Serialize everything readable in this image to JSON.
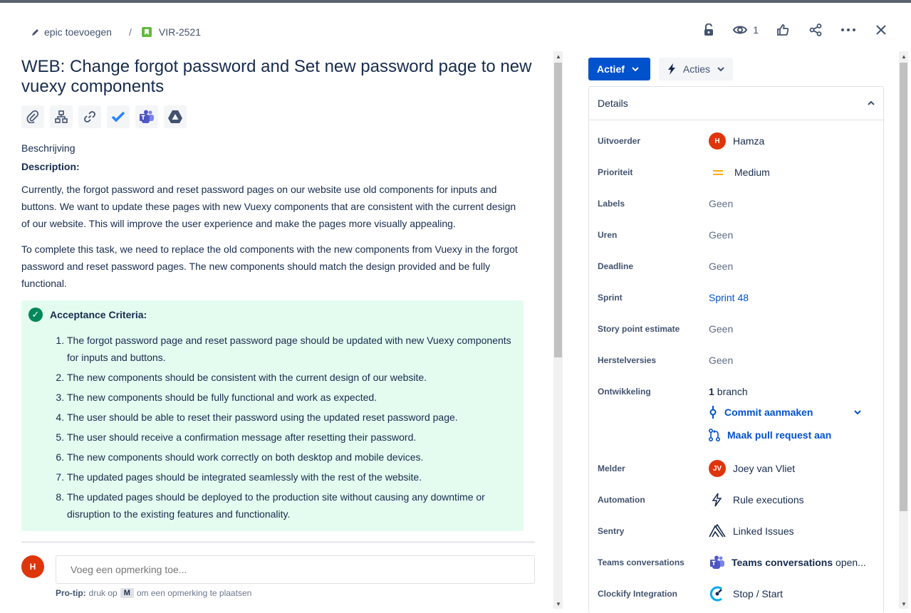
{
  "breadcrumb": {
    "parent_label": "epic toevoegen",
    "separator": "/",
    "issue_key": "VIR-2521"
  },
  "top_actions": {
    "watch_count": "1"
  },
  "issue": {
    "title": "WEB: Change forgot password and Set new password page to new vuexy components",
    "section_label": "Beschrijving",
    "description_heading": "Description:",
    "paragraphs": [
      "Currently, the forgot password and reset password pages on our website use old components for inputs and buttons. We want to update these pages with new Vuexy components that are consistent with the current design of our website. This will improve the user experience and make the pages more visually appealing.",
      "To complete this task, we need to replace the old components with the new components from Vuexy in the forgot password and reset password pages. The new components should match the design provided and be fully functional."
    ],
    "criteria_title": "Acceptance Criteria:",
    "criteria": [
      "The forgot password page and reset password page should be updated with new Vuexy components for inputs and buttons.",
      "The new components should be consistent with the current design of our website.",
      "The new components should be fully functional and work as expected.",
      "The user should be able to reset their password using the updated reset password page.",
      "The user should receive a confirmation message after resetting their password.",
      "The new components should work correctly on both desktop and mobile devices.",
      "The updated pages should be integrated seamlessly with the rest of the website.",
      "The updated pages should be deployed to the production site without causing any downtime or disruption to the existing features and functionality."
    ]
  },
  "comment": {
    "avatar_initial": "H",
    "placeholder": "Voeg een opmerking toe...",
    "protip_label": "Pro-tip:",
    "protip_pre": "druk op",
    "protip_key": "M",
    "protip_post": "om een opmerking te plaatsen"
  },
  "status": {
    "status_label": "Actief",
    "actions_label": "Acties"
  },
  "details": {
    "header": "Details",
    "fields": {
      "assignee_label": "Uitvoerder",
      "assignee_initial": "H",
      "assignee_value": "Hamza",
      "priority_label": "Prioriteit",
      "priority_value": "Medium",
      "labels_label": "Labels",
      "labels_value": "Geen",
      "hours_label": "Uren",
      "hours_value": "Geen",
      "deadline_label": "Deadline",
      "deadline_value": "Geen",
      "sprint_label": "Sprint",
      "sprint_value": "Sprint 48",
      "story_label": "Story point estimate",
      "story_value": "Geen",
      "fix_label": "Herstelversies",
      "fix_value": "Geen",
      "dev_label": "Ontwikkeling",
      "dev_count": "1",
      "dev_value": "branch",
      "commit_label": "Commit aanmaken",
      "pr_label": "Maak pull request aan",
      "reporter_label": "Melder",
      "reporter_initials": "JV",
      "reporter_value": "Joey van Vliet",
      "automation_label": "Automation",
      "automation_value": "Rule executions",
      "sentry_label": "Sentry",
      "sentry_value": "Linked Issues",
      "teams_label": "Teams conversations",
      "teams_value_bold": "Teams conversations",
      "teams_value_rest": "open...",
      "clockify_label": "Clockify Integration",
      "clockify_value": "Stop / Start"
    }
  },
  "colors": {
    "primary": "#0052cc",
    "criteria_bg": "#e3fcef",
    "avatar": "#de350b",
    "story": "#63ba3c"
  }
}
